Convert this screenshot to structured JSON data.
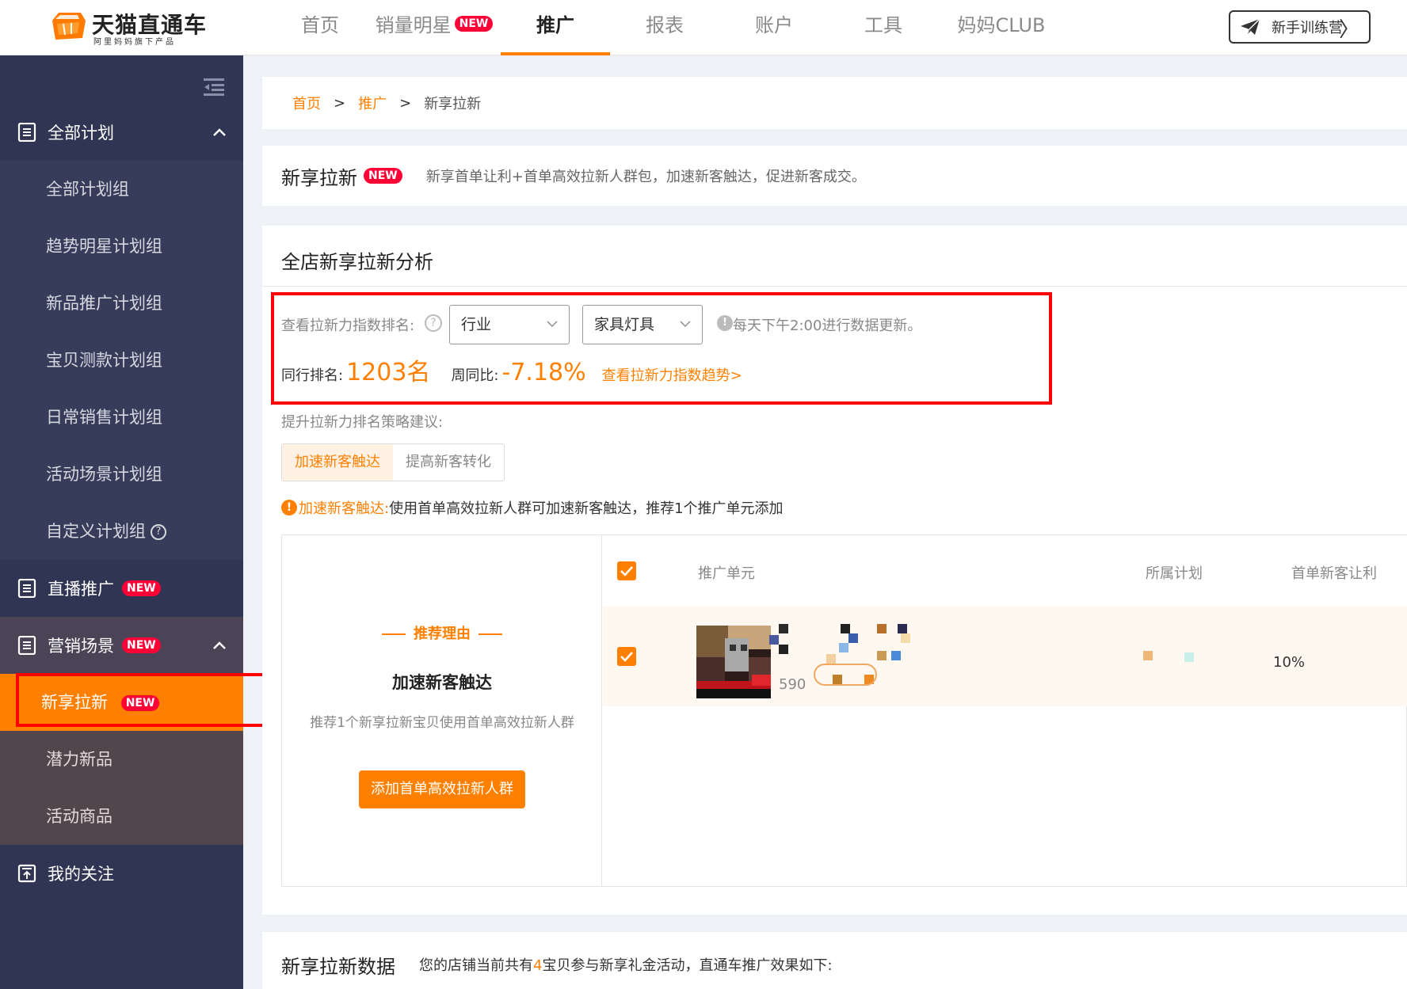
{
  "app": {
    "logo_title": "天猫直通车",
    "logo_sub": "阿里妈妈旗下产品"
  },
  "nav": {
    "items": [
      {
        "label": "首页"
      },
      {
        "label": "销量明星",
        "badge": "NEW"
      },
      {
        "label": "推广",
        "active": true
      },
      {
        "label": "报表"
      },
      {
        "label": "账户"
      },
      {
        "label": "工具"
      },
      {
        "label": "妈妈CLUB"
      }
    ],
    "trainer_button": "新手训练营"
  },
  "sidebar": {
    "collapse_icon": "menu-fold-icon",
    "group_all": "全部计划",
    "all_items": [
      "全部计划组",
      "趋势明星计划组",
      "新品推广计划组",
      "宝贝测款计划组",
      "日常销售计划组",
      "活动场景计划组",
      "自定义计划组"
    ],
    "live_label": "直播推广",
    "live_badge": "NEW",
    "marketing_label": "营销场景",
    "marketing_badge": "NEW",
    "active_item": "新享拉新",
    "active_badge": "NEW",
    "marketing_items": [
      "潜力新品",
      "活动商品"
    ],
    "follow_label": "我的关注"
  },
  "breadcrumb": {
    "home": "首页",
    "sep": ">",
    "promo": "推广",
    "current": "新享拉新"
  },
  "intro": {
    "title": "新享拉新",
    "badge": "NEW",
    "desc": "新享首单让利+首单高效拉新人群包，加速新客触达，促进新客成交。"
  },
  "analysis": {
    "title": "全店新享拉新分析",
    "query_label": "查看拉新力指数排名:",
    "select_industry": "行业",
    "select_category": "家具灯具",
    "update_note": "每天下午2:00进行数据更新。",
    "rank_label": "同行排名:",
    "rank_value": "1203名",
    "wow_label": "周同比:",
    "wow_value": "-7.18%",
    "trend_link": "查看拉新力指数趋势>",
    "strategy_label": "提升拉新力排名策略建议:",
    "tabs": [
      "加速新客触达",
      "提高新客转化"
    ],
    "tip_label": "加速新客触达:",
    "tip_text": "使用首单高效拉新人群可加速新客触达，推荐1个推广单元添加"
  },
  "reco": {
    "head": "推荐理由",
    "title": "加速新客触达",
    "desc": "推荐1个新享拉新宝贝使用首单高效拉新人群",
    "button": "添加首单高效拉新人群"
  },
  "table": {
    "headers": [
      "推广单元",
      "所属计划",
      "首单新客让利"
    ],
    "rows": [
      {
        "sold": "590",
        "discount": "10%"
      }
    ]
  },
  "data_section": {
    "title": "新享拉新数据",
    "desc_pre": "您的店铺当前共有",
    "desc_num": "4",
    "desc_post": "宝贝参与新享礼金活动，直通车推广效果如下:"
  },
  "colors": {
    "accent": "#ff8000",
    "sidebar_bg": "#2f3553",
    "badge_red": "#ff0036",
    "highlight_red": "#ff0000"
  }
}
